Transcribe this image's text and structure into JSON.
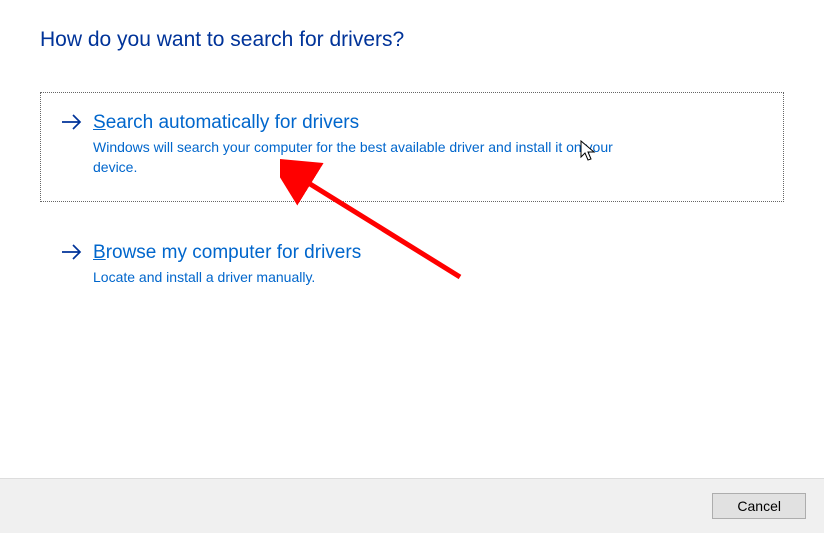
{
  "title": "How do you want to search for drivers?",
  "options": [
    {
      "accesskey": "S",
      "title_rest": "earch automatically for drivers",
      "description": "Windows will search your computer for the best available driver and install it on your device."
    },
    {
      "accesskey": "B",
      "title_rest": "rowse my computer for drivers",
      "description": "Locate and install a driver manually."
    }
  ],
  "buttons": {
    "cancel": "Cancel"
  }
}
